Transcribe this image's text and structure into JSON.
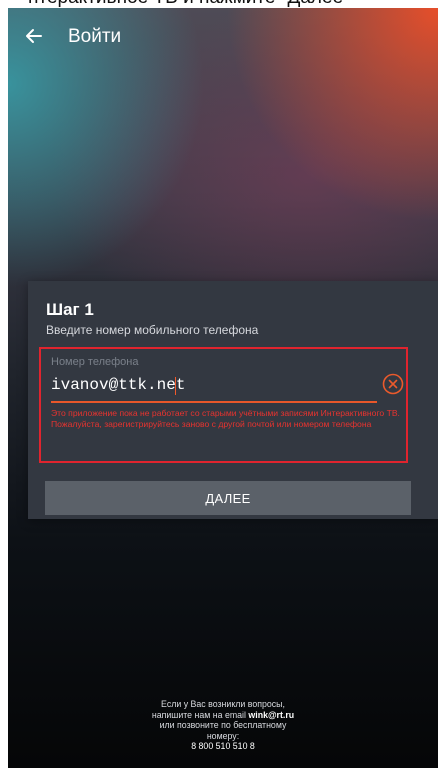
{
  "caption": "нтерактивное ТВ и нажмите \"Далее\"",
  "topbar": {
    "title": "Войти",
    "back_icon": "arrow-left-icon"
  },
  "card": {
    "step_title": "Шаг 1",
    "step_subtitle": "Введите номер мобильного телефона",
    "field": {
      "label": "Номер телефона",
      "value": "ivanov@ttk.net",
      "clear_icon": "clear-circle-icon",
      "error": "Это приложение пока не работает со старыми учётными записями Интерактивного ТВ. Пожалуйста, зарегистрируйтесь заново с другой почтой или номером телефона"
    },
    "next_label": "ДАЛЕЕ"
  },
  "footer": {
    "line1": "Если у Вас возникли вопросы,",
    "line2_prefix": "напишите нам на email ",
    "email": "wink@rt.ru",
    "line3": "или позвоните по бесплатному",
    "line4": "номеру:",
    "phone": "8 800 510 510 8"
  },
  "colors": {
    "accent_orange": "#e8572a",
    "error_red": "#e0242e",
    "card_bg": "#333841",
    "button_bg": "#5b6169"
  }
}
